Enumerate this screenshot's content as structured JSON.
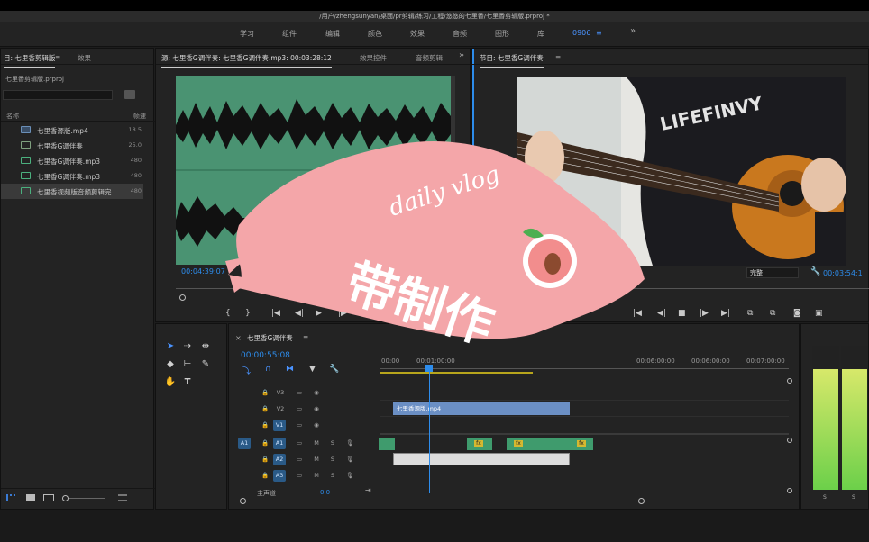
{
  "window": {
    "title": "/用户/zhengsunyan/桌面/pr剪辑/练习/工程/悠悠的七里香/七里香剪辑版.prproj *"
  },
  "workspaces": {
    "items": [
      "学习",
      "组件",
      "编辑",
      "颜色",
      "效果",
      "音频",
      "图形",
      "库"
    ],
    "active": "0906",
    "menu_glyph": "≡",
    "more": "»"
  },
  "project": {
    "tab_title": "目: 七里香剪辑版",
    "menu_glyph": "≡",
    "tab_effects": "效果",
    "file_name": "七里香剪辑版.prproj",
    "col_name": "名称",
    "col_rate": "帧速",
    "items": [
      {
        "name": "七里香源版.mp4",
        "rate": "18.5"
      },
      {
        "name": "七里香G调伴奏",
        "rate": "25.0"
      },
      {
        "name": "七里香G调伴奏.mp3",
        "rate": "480"
      },
      {
        "name": "七里香G调伴奏.mp3",
        "rate": "480"
      },
      {
        "name": "七里香视频版音频剪辑完",
        "rate": "480"
      }
    ]
  },
  "source": {
    "tab_title": "源: 七里香G调伴奏: 七里香G调伴奏.mp3: 00:03:28:12",
    "tab_effect_controls": "效果控件",
    "tab_audio": "音频剪辑",
    "more": "»",
    "timecode": "00:04:39:07"
  },
  "program": {
    "tab_title": "节目: 七里香G调伴奏",
    "menu_glyph": "≡",
    "quality": "完整",
    "timecode": "00:03:54:1",
    "shirt_text": "LIFEFINVY"
  },
  "timeline": {
    "close_glyph": "×",
    "sequence_name": "七里香G调伴奏",
    "menu_glyph": "≡",
    "timecode": "00:00:55:08",
    "ruler": [
      "00:00",
      "00:01:00:00",
      "00:06:00:00",
      "00:06:00:00",
      "00:07:00:00"
    ],
    "tracks": [
      {
        "id": "V3",
        "src": ""
      },
      {
        "id": "V2",
        "src": ""
      },
      {
        "id": "V1",
        "src": ""
      },
      {
        "id": "A1",
        "src": "A1"
      },
      {
        "id": "A2",
        "src": ""
      },
      {
        "id": "A3",
        "src": ""
      }
    ],
    "track_letters": {
      "mute": "M",
      "solo": "S"
    },
    "master_label": "主声道",
    "master_value": "0.0",
    "clip_v2": "七里香源版.mp4",
    "clip_fx": "fx"
  },
  "overlay": {
    "script": "daily vlog",
    "title": "带制作"
  },
  "meter": {
    "labels": [
      "S",
      "S"
    ]
  },
  "colors": {
    "accent": "#2d8ceb",
    "waveform_bg": "#4a9372",
    "sticker": "#f4a6a9",
    "clip_video": "#6b8fc4",
    "clip_audio": "#3f9b6d"
  }
}
